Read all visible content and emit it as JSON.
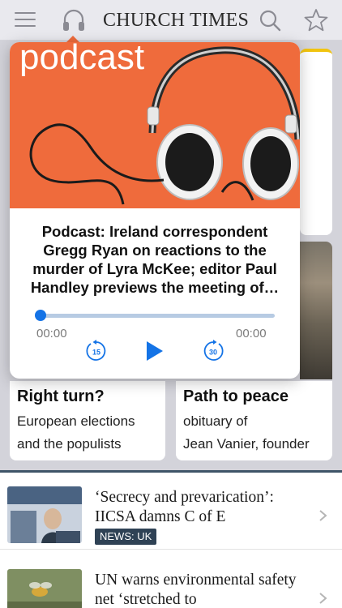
{
  "header": {
    "brand": "CHURCH TIMES",
    "icons": [
      "menu-icon",
      "headphones-icon",
      "search-icon",
      "star-icon"
    ]
  },
  "background_cards": [
    {
      "title": "Right turn?",
      "subtitle_lines": [
        "European elections",
        "and the populists"
      ]
    },
    {
      "title": "Path to peace",
      "subtitle_lines": [
        "obituary of",
        "Jean Vanier, founder"
      ]
    }
  ],
  "podcast_popover": {
    "image_word": "podcast",
    "title": "Podcast: Ireland correspondent Gregg Ryan on reactions to the murder of Lyra McKee; editor Paul Handley previews the meeting of…",
    "elapsed": "00:00",
    "duration": "00:00",
    "progress": 0,
    "skip_back_label": "15",
    "skip_forward_label": "30",
    "accent": "#1473e6"
  },
  "articles": [
    {
      "title": "‘Secrecy and prevarication’: IICSA damns C of E",
      "badge": "NEWS: UK"
    },
    {
      "title": "UN warns environmental safety net ‘stretched to",
      "badge": ""
    }
  ]
}
